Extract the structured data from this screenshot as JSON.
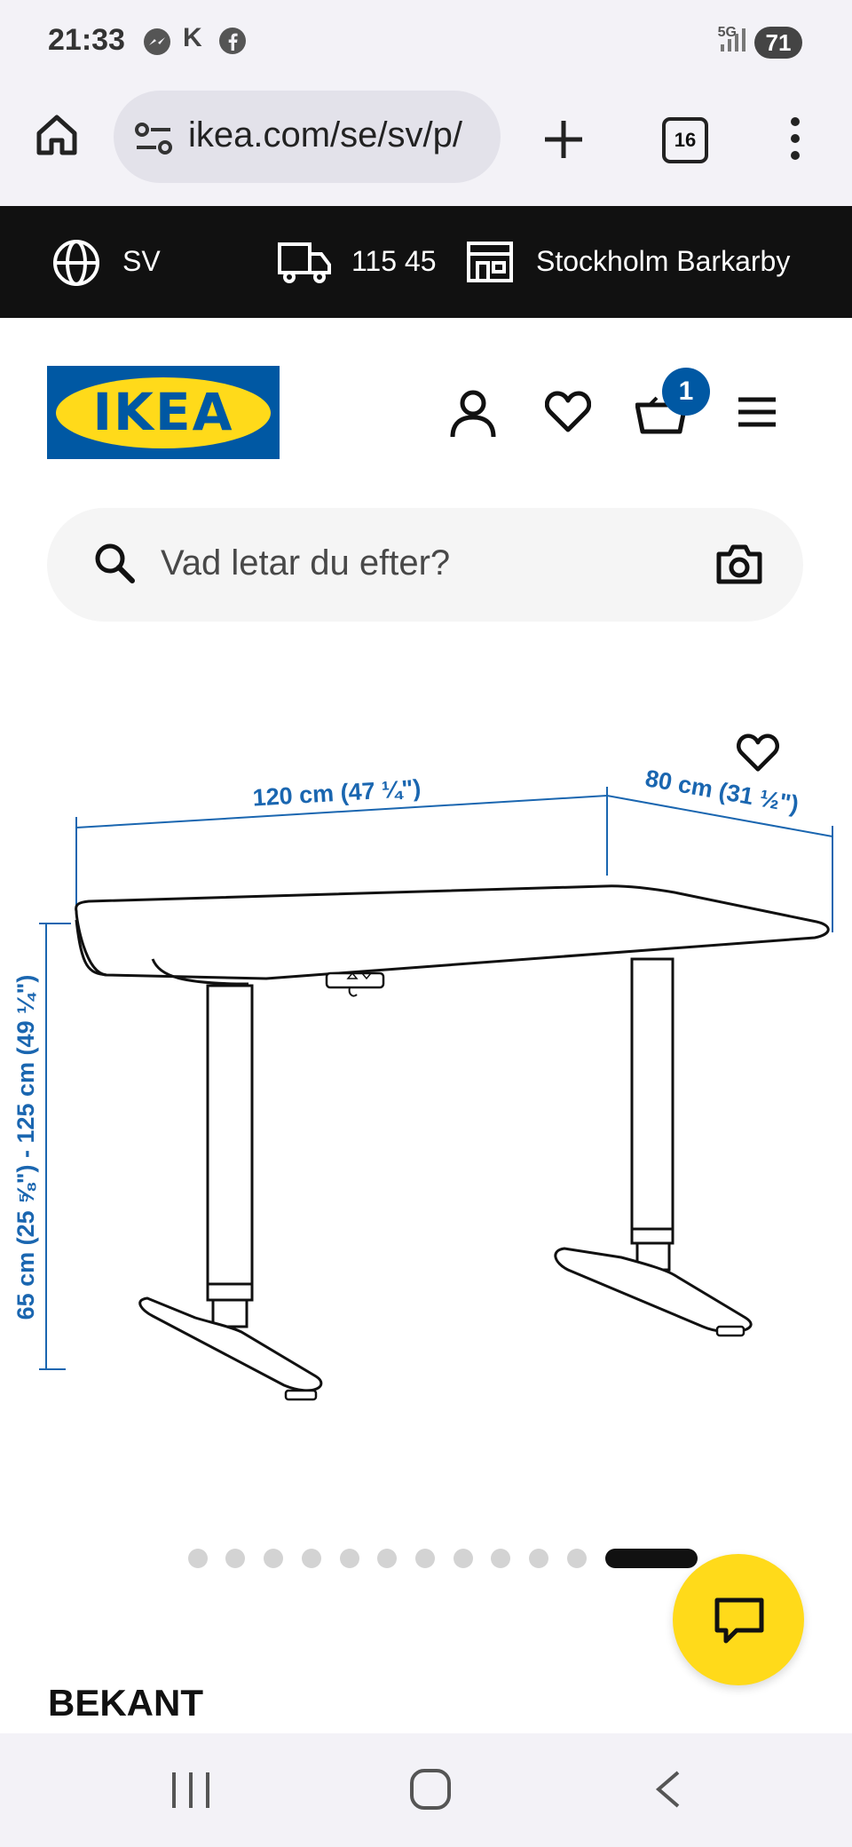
{
  "status_bar": {
    "time": "21:33",
    "notification_icons": [
      "messenger-icon",
      "k-app-icon",
      "facebook-icon"
    ],
    "network": "5G",
    "battery": "71"
  },
  "browser": {
    "url": "ikea.com/se/sv/p/",
    "tab_count": "16",
    "icons": [
      "home-icon",
      "site-settings-icon",
      "new-tab-icon",
      "tabs-icon",
      "more-icon"
    ]
  },
  "info_bar": {
    "language": "SV",
    "postal_code": "115 45",
    "store": "Stockholm Barkarby"
  },
  "header": {
    "logo_text": "IKEA",
    "cart_count": "1",
    "search_placeholder": "Vad letar du efter?"
  },
  "product": {
    "dimension_width": "120 cm (47 ¼\")",
    "dimension_depth": "80 cm (31 ½\")",
    "dimension_height": "65 cm (25 ⅝\") - 125 cm (49 ¼\")",
    "name": "BEKANT",
    "image_count": 12,
    "active_image": 12
  },
  "colors": {
    "ikea_blue": "#0058a3",
    "ikea_yellow": "#ffda1a",
    "dimension_blue": "#1a66b0"
  }
}
